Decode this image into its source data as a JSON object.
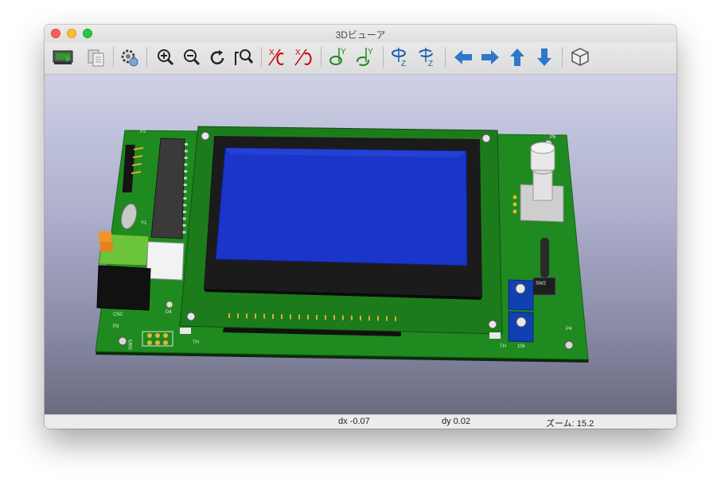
{
  "window": {
    "title": "3Dビューア"
  },
  "toolbar": {
    "buttons": [
      {
        "name": "reload-board-icon"
      },
      {
        "name": "copy-image-icon"
      },
      {
        "name": "preferences-gear-icon"
      },
      {
        "name": "zoom-in-icon"
      },
      {
        "name": "zoom-out-icon"
      },
      {
        "name": "redraw-icon"
      },
      {
        "name": "zoom-fit-icon"
      },
      {
        "name": "rotate-x-cw-icon"
      },
      {
        "name": "rotate-x-ccw-icon"
      },
      {
        "name": "rotate-y-cw-icon"
      },
      {
        "name": "rotate-y-ccw-icon"
      },
      {
        "name": "rotate-z-cw-icon"
      },
      {
        "name": "rotate-z-ccw-icon"
      },
      {
        "name": "pan-left-icon"
      },
      {
        "name": "pan-right-icon"
      },
      {
        "name": "pan-up-icon"
      },
      {
        "name": "pan-down-icon"
      },
      {
        "name": "ortho-view-icon"
      }
    ],
    "axis_labels": {
      "x": "X",
      "y": "Y",
      "z": "Z"
    }
  },
  "pcb": {
    "refs": {
      "p2": "P2",
      "p5": "P5",
      "sw2": "SW2",
      "p4": "P4",
      "cn2": "CN2",
      "p3": "P3",
      "d4": "D4",
      "sw3": "SW3",
      "y1": "Y1",
      "th_left": "TH",
      "th_right": "TH",
      "pot_value": "10k"
    },
    "colors": {
      "board": "#1f8a1f",
      "lcd": "#1a35c8",
      "bezel": "#1b1b1b"
    }
  },
  "status": {
    "dx": "dx -0.07",
    "dy": "dy 0.02",
    "zoom": "ズーム: 15.2"
  }
}
